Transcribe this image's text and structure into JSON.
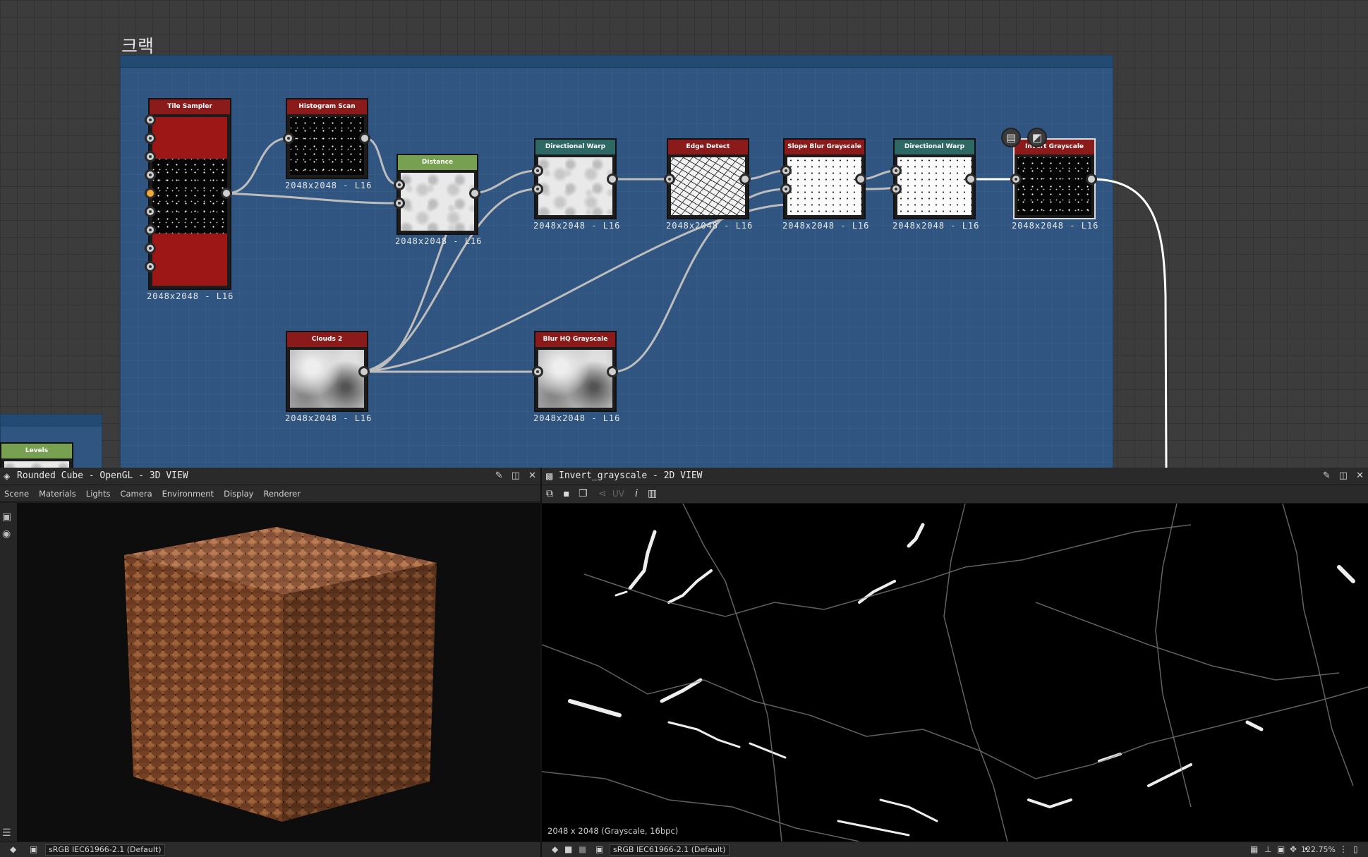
{
  "graph": {
    "frame_title": "크랙",
    "nodes": {
      "tile_sampler": {
        "title": "Tile Sampler",
        "label": "2048x2048 - L16"
      },
      "histogram_scan": {
        "title": "Histogram Scan",
        "label": "2048x2048 - L16"
      },
      "distance": {
        "title": "Distance",
        "label": "2048x2048 - L16"
      },
      "directional_warp_1": {
        "title": "Directional Warp",
        "label": "2048x2048 - L16"
      },
      "edge_detect": {
        "title": "Edge Detect",
        "label": "2048x2048 - L16"
      },
      "slope_blur": {
        "title": "Slope Blur Grayscale",
        "label": "2048x2048 - L16"
      },
      "directional_warp_2": {
        "title": "Directional Warp",
        "label": "2048x2048 - L16"
      },
      "invert_grayscale": {
        "title": "Invert Grayscale",
        "label": "2048x2048 - L16"
      },
      "clouds_2": {
        "title": "Clouds 2",
        "label": "2048x2048 - L16"
      },
      "blur_hq": {
        "title": "Blur HQ Grayscale",
        "label": "2048x2048 - L16"
      },
      "levels": {
        "title": "Levels"
      }
    },
    "overlay_icons": [
      "document-icon",
      "checker-icon"
    ]
  },
  "view3d": {
    "title": "Rounded Cube - OpenGL - 3D VIEW",
    "menu": [
      "Scene",
      "Materials",
      "Lights",
      "Camera",
      "Environment",
      "Display",
      "Renderer"
    ],
    "color_profile": "sRGB IEC61966-2.1 (Default)"
  },
  "view2d": {
    "title": "Invert_grayscale - 2D VIEW",
    "uv_label": "UV",
    "resolution_text": "2048 x 2048 (Grayscale, 16bpc)",
    "color_profile": "sRGB IEC61966-2.1 (Default)",
    "zoom": "122.75%"
  },
  "colors": {
    "frame_blue": "#2f5580",
    "node_red": "#8b1a1a",
    "node_teal": "#2e6864",
    "node_green": "#77a150",
    "port_active": "#f2a83a"
  }
}
